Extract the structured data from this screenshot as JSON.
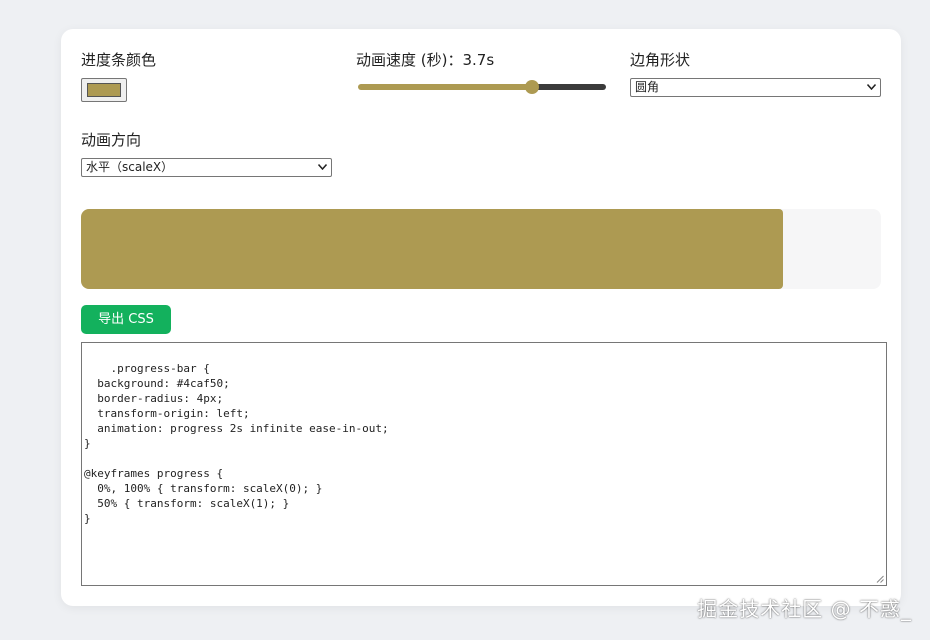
{
  "controls": {
    "color": {
      "label": "进度条颜色",
      "value": "#ad9a52"
    },
    "speed": {
      "label": "动画速度 (秒)：",
      "value_text": "3.7s",
      "fraction": 0.7
    },
    "shape": {
      "label": "边角形状",
      "selected": "圆角"
    },
    "direction": {
      "label": "动画方向",
      "selected": "水平（scaleX）"
    }
  },
  "preview": {
    "progress": 0.877,
    "bar_color": "#ad9a52",
    "track_color": "#f6f6f7"
  },
  "export_button": {
    "label": "导出 CSS",
    "color": "#13b15d"
  },
  "code_output": ".progress-bar {\n  background: #4caf50;\n  border-radius: 4px;\n  transform-origin: left;\n  animation: progress 2s infinite ease-in-out;\n}\n\n@keyframes progress {\n  0%, 100% { transform: scaleX(0); }\n  50% { transform: scaleX(1); }\n}",
  "watermark": "掘金技术社区 @ 不惑_",
  "colors": {
    "page_bg": "#eef0f3",
    "card_bg": "#ffffff",
    "slider_dark": "#3b3b3b"
  }
}
